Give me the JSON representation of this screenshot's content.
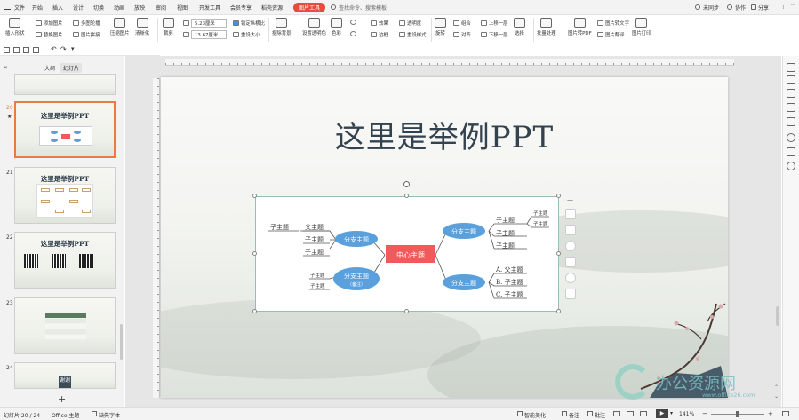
{
  "menu": {
    "file": "文件",
    "items": [
      "开始",
      "插入",
      "设计",
      "切换",
      "动画",
      "放映",
      "审阅",
      "视图",
      "开发工具",
      "会员专享",
      "稻壳资源"
    ],
    "active_tab": "图片工具",
    "search": "查找命令、搜索模板",
    "right": [
      "未同步",
      "协作",
      "分享"
    ]
  },
  "ribbon": {
    "insert_shape": "插入形状",
    "add_image": "添加图片",
    "replace_image": "替换图片",
    "multi_crop": "多图轮播",
    "image_combine": "图片拼接",
    "compress": "压缩图片",
    "clarity": "清晰化",
    "crop": "裁剪",
    "width": "5.23厘米",
    "height": "13.67厘米",
    "lock_ratio": "锁定纵横比",
    "reset_size": "重设大小",
    "remove_bg": "抠除背景",
    "set_transparent": "设置透明色",
    "color": "色彩",
    "effect": "效果",
    "border": "边框",
    "transparency": "透明度",
    "reset_style": "重设样式",
    "rotate": "旋转",
    "combine": "组合",
    "align": "对齐",
    "bring_forward": "上移一层",
    "send_backward": "下移一层",
    "select": "选择",
    "batch": "批量处理",
    "to_pdf": "图片转PDF",
    "to_text": "图片转文字",
    "translate": "图片翻译",
    "print": "图片打印"
  },
  "panel": {
    "tab_outline": "大纲",
    "tab_slides": "幻灯片",
    "slides": [
      {
        "num": "20",
        "title": "这里是举例PPT"
      },
      {
        "num": "21",
        "title": "这里是举例PPT"
      },
      {
        "num": "22",
        "title": "这里是举例PPT"
      },
      {
        "num": "23",
        "title": ""
      },
      {
        "num": "24",
        "title": "谢谢"
      }
    ],
    "add": "+"
  },
  "slide": {
    "title": "这里是举例PPT",
    "center": "中心主题",
    "branch": "分支主题",
    "branch_note": "（备注）",
    "sub": "子主题",
    "parent": "父主题",
    "sub_a": "A. 父主题",
    "sub_b": "B. 子主题",
    "sub_c": "C. 子主题"
  },
  "status": {
    "slide_info": "幻灯片 20 / 24",
    "theme": "Office 主题",
    "missing_font": "缺失字体",
    "beautify": "智能美化",
    "notes": "备注",
    "comment": "批注",
    "zoom": "141%"
  },
  "watermark": {
    "text": "办公资源网",
    "url": "www.office26.com"
  },
  "colors": {
    "accent": "#e84a3d",
    "bubble": "#5aa0dc",
    "center": "#f05a5a",
    "selection": "#e97b46"
  }
}
